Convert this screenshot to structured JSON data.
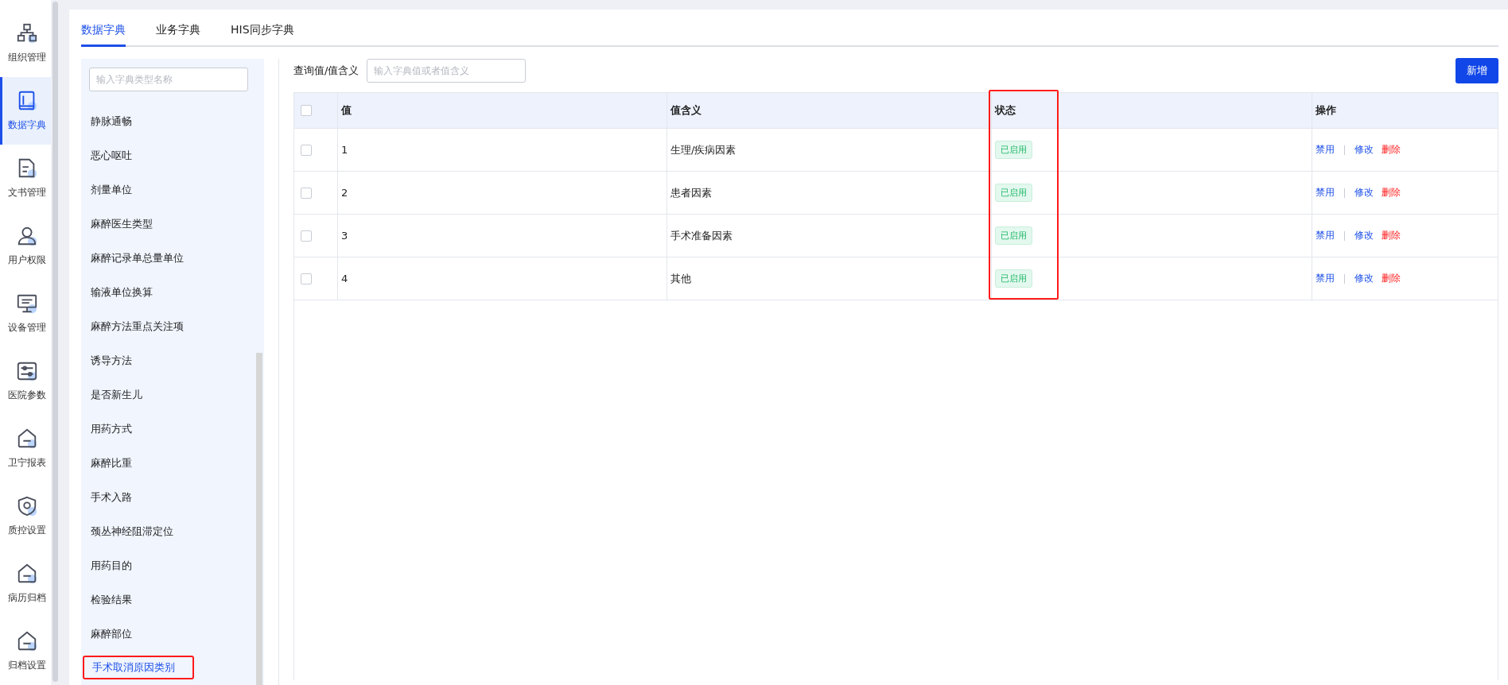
{
  "nav": {
    "items": [
      {
        "label": "组织管理",
        "selected": false
      },
      {
        "label": "数据字典",
        "selected": true
      },
      {
        "label": "文书管理",
        "selected": false
      },
      {
        "label": "用户权限",
        "selected": false
      },
      {
        "label": "设备管理",
        "selected": false
      },
      {
        "label": "医院参数",
        "selected": false
      },
      {
        "label": "卫宁报表",
        "selected": false
      },
      {
        "label": "质控设置",
        "selected": false
      },
      {
        "label": "病历归档",
        "selected": false
      },
      {
        "label": "归档设置",
        "selected": false
      }
    ]
  },
  "tabs": [
    {
      "label": "数据字典",
      "selected": true
    },
    {
      "label": "业务字典",
      "selected": false
    },
    {
      "label": "HIS同步字典",
      "selected": false
    }
  ],
  "dict_types": {
    "search": {
      "placeholder": "输入字典类型名称"
    },
    "items": [
      {
        "label": "静脉通畅",
        "selected": false,
        "highlighted": false
      },
      {
        "label": "恶心呕吐",
        "selected": false,
        "highlighted": false
      },
      {
        "label": "剂量单位",
        "selected": false,
        "highlighted": false
      },
      {
        "label": "麻醉医生类型",
        "selected": false,
        "highlighted": false
      },
      {
        "label": "麻醉记录单总量单位",
        "selected": false,
        "highlighted": false
      },
      {
        "label": "输液单位换算",
        "selected": false,
        "highlighted": false
      },
      {
        "label": "麻醉方法重点关注项",
        "selected": false,
        "highlighted": false
      },
      {
        "label": "诱导方法",
        "selected": false,
        "highlighted": false
      },
      {
        "label": "是否新生儿",
        "selected": false,
        "highlighted": false
      },
      {
        "label": "用药方式",
        "selected": false,
        "highlighted": false
      },
      {
        "label": "麻醉比重",
        "selected": false,
        "highlighted": false
      },
      {
        "label": "手术入路",
        "selected": false,
        "highlighted": false
      },
      {
        "label": "颈丛神经阻滞定位",
        "selected": false,
        "highlighted": false
      },
      {
        "label": "用药目的",
        "selected": false,
        "highlighted": false
      },
      {
        "label": "检验结果",
        "selected": false,
        "highlighted": false
      },
      {
        "label": "麻醉部位",
        "selected": false,
        "highlighted": false
      },
      {
        "label": "手术取消原因类别",
        "selected": true,
        "highlighted": true
      }
    ]
  },
  "query": {
    "label": "查询值/值含义",
    "placeholder": "输入字典值或者值含义"
  },
  "add_button": "新增",
  "table": {
    "select_all": {
      "checked": false
    },
    "columns": [
      {
        "label": "值",
        "highlighted": false
      },
      {
        "label": "值含义",
        "highlighted": false
      },
      {
        "label": "状态",
        "highlighted": true
      },
      {
        "label": "操作",
        "highlighted": false
      }
    ],
    "rows": [
      {
        "checked": false,
        "value": "1",
        "meaning": "生理/疾病因素",
        "status": "已启用",
        "actions": [
          {
            "label": "禁用",
            "kind": "toggle"
          },
          {
            "label": "修改",
            "kind": "edit"
          },
          {
            "label": "删除",
            "kind": "delete"
          }
        ]
      },
      {
        "checked": false,
        "value": "2",
        "meaning": "患者因素",
        "status": "已启用",
        "actions": [
          {
            "label": "禁用",
            "kind": "toggle"
          },
          {
            "label": "修改",
            "kind": "edit"
          },
          {
            "label": "删除",
            "kind": "delete"
          }
        ]
      },
      {
        "checked": false,
        "value": "3",
        "meaning": "手术准备因素",
        "status": "已启用",
        "actions": [
          {
            "label": "禁用",
            "kind": "toggle"
          },
          {
            "label": "修改",
            "kind": "edit"
          },
          {
            "label": "删除",
            "kind": "delete"
          }
        ]
      },
      {
        "checked": false,
        "value": "4",
        "meaning": "其他",
        "status": "已启用",
        "actions": [
          {
            "label": "禁用",
            "kind": "toggle"
          },
          {
            "label": "修改",
            "kind": "edit"
          },
          {
            "label": "删除",
            "kind": "delete"
          }
        ]
      }
    ]
  }
}
